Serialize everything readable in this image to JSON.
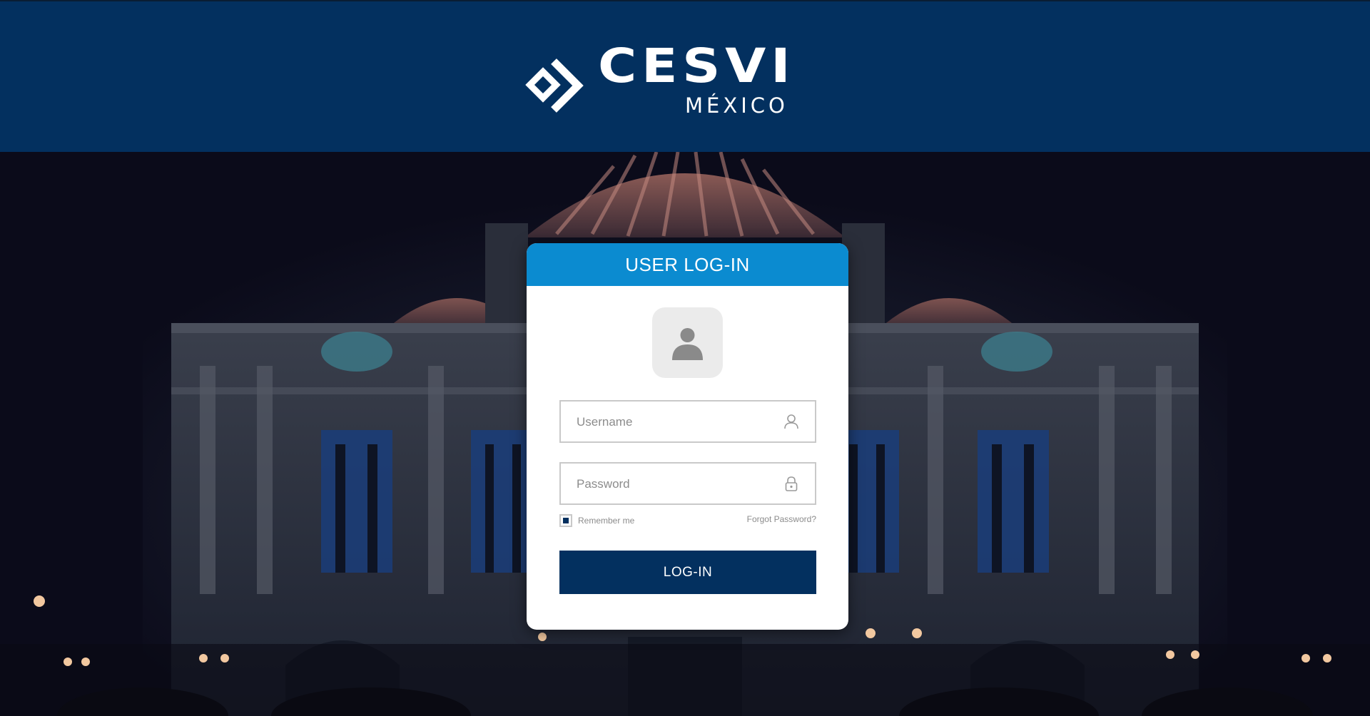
{
  "brand": {
    "name": "CESVI",
    "subtitle": "MÉXICO",
    "header_color": "#03305f"
  },
  "login": {
    "title": "USER LOG-IN",
    "title_bar_color": "#0b8bd0",
    "avatar_icon": "user-silhouette-icon",
    "username": {
      "placeholder": "Username",
      "value": "",
      "icon": "user-outline-icon"
    },
    "password": {
      "placeholder": "Password",
      "value": "",
      "icon": "lock-icon"
    },
    "remember_label": "Remember me",
    "remember_checked": true,
    "forgot_label": "Forgot Password?",
    "submit_label": "LOG-IN",
    "submit_color": "#03305f"
  }
}
